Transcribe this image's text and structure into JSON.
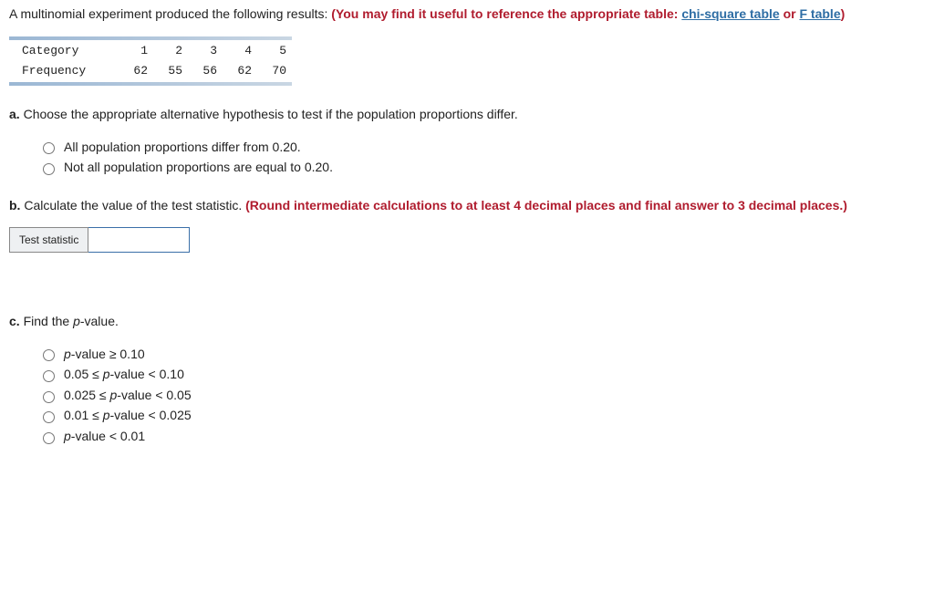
{
  "intro": {
    "prefix": "A multinomial experiment produced the following results: ",
    "bold_part": "(You may find it useful to reference the appropriate table: ",
    "link1": "chi-square table",
    "bold_or": " or ",
    "link2": "F table",
    "bold_close": ")"
  },
  "data_table": {
    "row_labels": [
      "Category",
      "Frequency"
    ],
    "categories": [
      "1",
      "2",
      "3",
      "4",
      "5"
    ],
    "frequencies": [
      "62",
      "55",
      "56",
      "62",
      "70"
    ]
  },
  "part_a": {
    "label": "a.",
    "text": " Choose the appropriate alternative hypothesis to test if the population proportions differ.",
    "options": [
      "All population proportions differ from 0.20.",
      "Not all population proportions are equal to 0.20."
    ]
  },
  "part_b": {
    "label": "b.",
    "text": " Calculate the value of the test statistic. ",
    "bold_part": "(Round intermediate calculations to at least 4 decimal places and final answer to 3 decimal places.)",
    "stat_label": "Test statistic"
  },
  "part_c": {
    "label": "c.",
    "text_prefix": " Find the ",
    "p": "p",
    "text_suffix": "-value.",
    "options": [
      {
        "pre": "",
        "p": "p",
        "post": "-value ≥ 0.10"
      },
      {
        "pre": "0.05 ≤ ",
        "p": "p",
        "post": "-value < 0.10"
      },
      {
        "pre": "0.025 ≤ ",
        "p": "p",
        "post": "-value < 0.05"
      },
      {
        "pre": "0.01 ≤ ",
        "p": "p",
        "post": "-value < 0.025"
      },
      {
        "pre": "",
        "p": "p",
        "post": "-value < 0.01"
      }
    ]
  }
}
